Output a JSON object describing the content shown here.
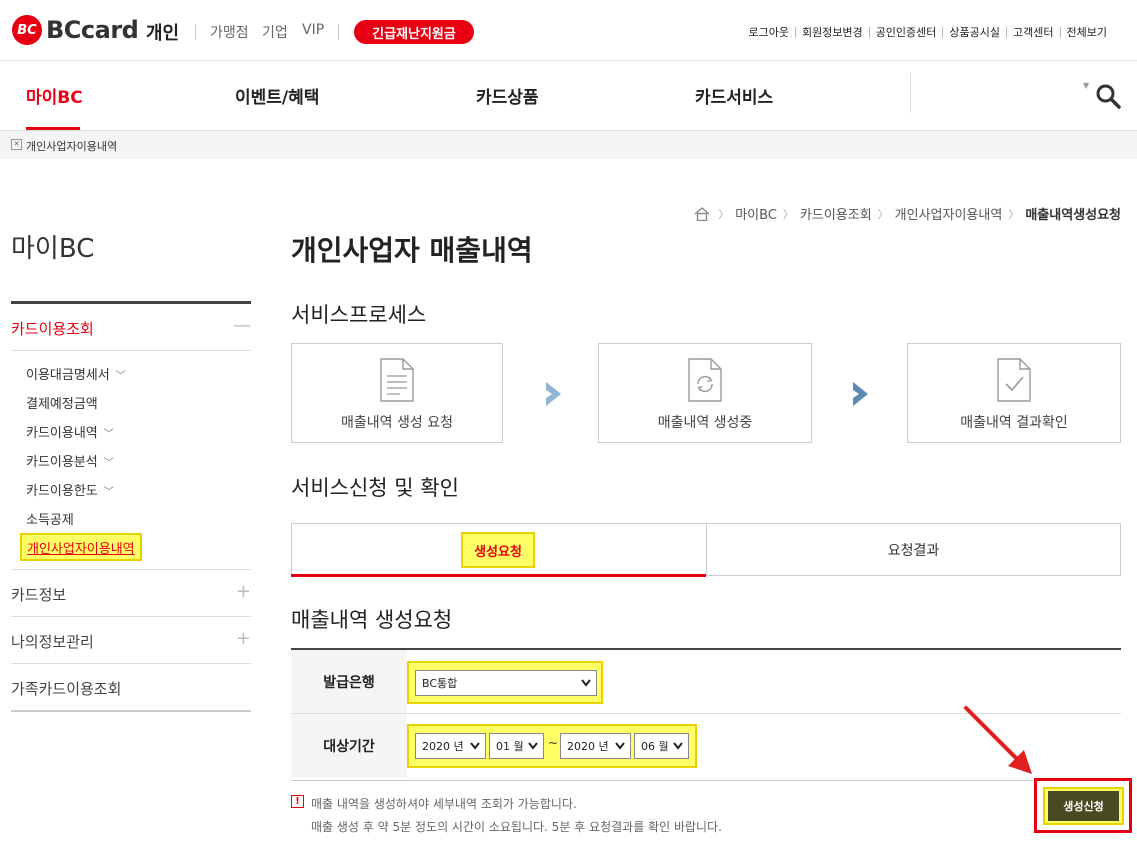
{
  "header": {
    "logo_text": "BCcard",
    "logo_mark": "BC",
    "section": "개인",
    "links": [
      "가맹점",
      "기업",
      "VIP"
    ],
    "emergency_button": "긴급재난지원금",
    "util_links": [
      "로그아웃",
      "회원정보변경",
      "공인인증센터",
      "상품공시실",
      "고객센터",
      "전체보기"
    ]
  },
  "gnb": {
    "items": [
      "마이BC",
      "이벤트/혜택",
      "카드상품",
      "카드서비스"
    ],
    "active": "마이BC"
  },
  "location_bar": {
    "text": "개인사업자이용내역"
  },
  "breadcrumb": [
    "마이BC",
    "카드이용조회",
    "개인사업자이용내역",
    "매출내역생성요청"
  ],
  "sidebar": {
    "title": "마이BC",
    "sections": [
      {
        "label": "카드이용조회",
        "sign": "—"
      },
      {
        "label": "카드정보",
        "sign": "+"
      },
      {
        "label": "나의정보관리",
        "sign": "+"
      },
      {
        "label": "가족카드이용조회"
      }
    ],
    "sub_items": [
      {
        "label": "이용대금명세서",
        "expand": "﹀"
      },
      {
        "label": "결제예정금액"
      },
      {
        "label": "카드이용내역",
        "expand": "﹀"
      },
      {
        "label": "카드이용분석",
        "expand": "﹀"
      },
      {
        "label": "카드이용한도",
        "expand": "﹀"
      },
      {
        "label": "소득공제"
      },
      {
        "label": "개인사업자이용내역"
      }
    ]
  },
  "main": {
    "title": "개인사업자 매출내역",
    "process_title": "서비스프로세스",
    "process_steps": [
      "매출내역 생성 요청",
      "매출내역 생성중",
      "매출내역 결과확인"
    ],
    "service_title": "서비스신청 및 확인",
    "tabs": [
      "생성요청",
      "요청결과"
    ],
    "form_title": "매출내역 생성요청",
    "form": {
      "bank_label": "발급은행",
      "bank_value": "BC통합",
      "period_label": "대상기간",
      "from_year": "2020 년",
      "from_month": "01 월",
      "tilde": "~",
      "to_year": "2020 년",
      "to_month": "06 월"
    },
    "notice_mark": "!",
    "notes": [
      "매출 내역을 생성하셔야 세부내역 조회가 가능합니다.",
      "매출 생성 후 약 5분 정도의 시간이 소요됩니다. 5분 후 요청결과를 확인 바랍니다."
    ],
    "submit_button": "생성신청"
  },
  "colors": {
    "brand_red": "#e60012",
    "highlight_yellow": "#ffff66",
    "arrow_light": "#8fb4d6",
    "arrow_dark": "#5b8ab5"
  }
}
